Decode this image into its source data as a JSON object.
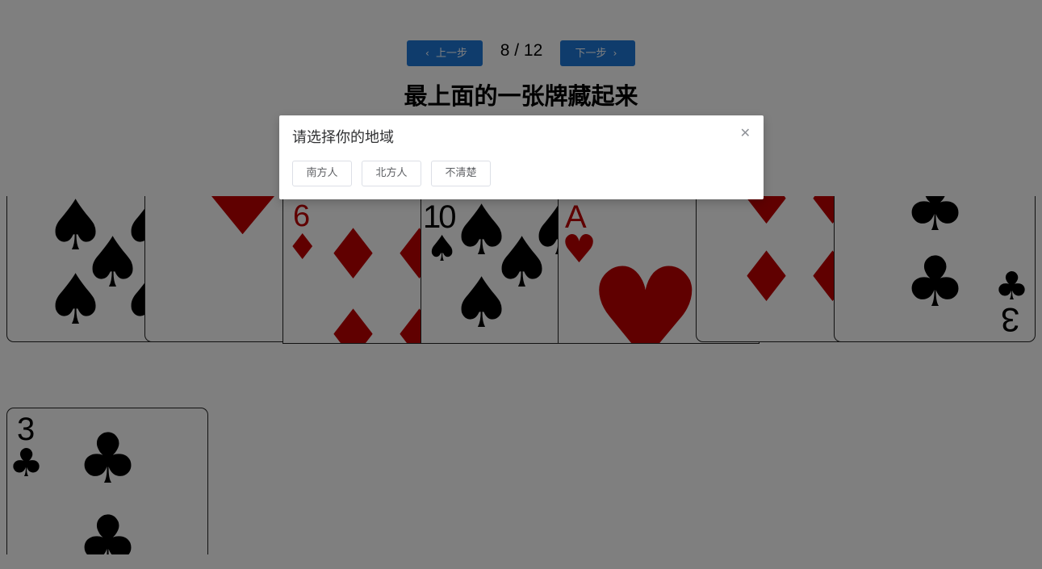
{
  "nav": {
    "prev_label": "上一步",
    "next_label": "下一步",
    "progress": "8 / 12",
    "current_step": 8,
    "total_steps": 12,
    "accent_color": "#1e78d9"
  },
  "title": "最上面的一张牌藏起来",
  "cards": [
    {
      "rank": "9",
      "suit": "spades"
    },
    {
      "rank": "",
      "suit": "hearts"
    },
    {
      "rank": "6",
      "suit": "diamonds"
    },
    {
      "rank": "10",
      "suit": "spades"
    },
    {
      "rank": "A",
      "suit": "hearts"
    },
    {
      "rank": "",
      "suit": "diamonds"
    },
    {
      "rank": "3",
      "suit": "clubs"
    }
  ],
  "hidden_card": {
    "rank": "3",
    "suit": "clubs"
  },
  "dialog": {
    "title": "请选择你的地域",
    "close_icon": "close-icon",
    "options": [
      "南方人",
      "北方人",
      "不清楚"
    ]
  }
}
